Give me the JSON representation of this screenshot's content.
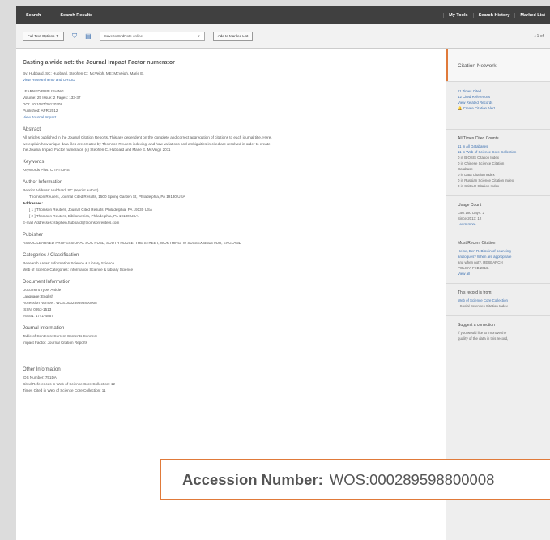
{
  "topbar": {
    "search": "Search",
    "search_results": "Search Results",
    "my_tools": "My Tools",
    "search_history": "Search History",
    "marked_list": "Marked List"
  },
  "toolbar": {
    "full_text": "Full Text Options ▼",
    "save_to": "Save to EndNote online",
    "add_marked": "Add to Marked List",
    "nav": "◂ 1 of"
  },
  "record": {
    "title": "Casting a wide net: the Journal Impact Factor numerator",
    "authors": "By: Hubbard, SC; Hubbard, Stephen C.; McVeigh, ME; McVeigh, Marie E.",
    "researcher": "View ResearcherID and ORCID",
    "publisher_short": "LEARNED PUBLISHING",
    "volume": "Volume: 25   Issue: 2   Pages: 133-37",
    "doi": "DOI: 10.1087/20120208",
    "published": "Published: APR 2012",
    "journal_impact": "View Journal Impact",
    "abstract_h": "Abstract",
    "abstract_1": "All articles published in the Journal Citation Reports. This are dependent on the complete and correct aggregation of citations to each journal title. Here,",
    "abstract_2": "we explain how unique data files are created by Thomson Reuters indexing, and how variations and ambiguities in cited are resolved in order to create",
    "abstract_3": "the Journal Impact Factor numerator. (c) Stephen C. Hubbard and Marie E. McVeigh 2011",
    "keywords_h": "Keywords",
    "keywords": "KeyWords Plus: CITATIONS",
    "author_info_h": "Author Information",
    "reprint": "Reprint Address: Hubbard, SC (reprint author)",
    "reprint_addr": "Thomson Reuters, Journal Cited Results, 1500 Spring Garden St, Philadelphia, PA 19130 USA",
    "addresses_h": "Addresses:",
    "addr1": "[ 1 ] Thomson Reuters, Journal Cited Results, Philadelphia, PA 19130 USA",
    "addr2": "[ 2 ] Thomson Reuters, Bibliometrics, Philadelphia, PA 19130 USA",
    "email": "E-mail Addresses: stephen.hubbard@thomsonreuters.com",
    "publisher_h": "Publisher",
    "publisher": "ASSOC LEARNED PROFESSIONAL SOC PUBL, SOUTH HOUSE, THE STREET, WORTHING, W SUSSEX BN14 0UU, ENGLAND",
    "categories_h": "Categories / Classification",
    "research_areas": "Research Areas: Information Science & Library Science",
    "wos_categories": "Web of Science Categories: Information Science & Library Science",
    "doc_info_h": "Document Information",
    "doc_type": "Document Type: Article",
    "language": "Language: English",
    "accession": "Accession Number: WOS:000289598800008",
    "issn": "ISSN: 0953-1513",
    "eissn": "eISSN: 1741-4857",
    "journal_info_h": "Journal Information",
    "toc": "Table of Contents: Current Contents Connect",
    "impact": "Impact Factor: Journal Citation Reports",
    "other_info_h": "Other Information",
    "ids": "IDS Number: 751DA",
    "cited_refs": "Cited References in Web of Science Core Collection: 12",
    "times_cited": "Times Cited in Web of Science Core Collection: 11"
  },
  "sidebar": {
    "header": "Citation Network",
    "times_cited": "11 Times Cited",
    "cited_refs": "12 Cited References",
    "related": "View Related Records",
    "alert": "Create Citation Alert",
    "all_times_h": "All Times Cited Counts",
    "atc1": "11 in All Databases",
    "atc2": "11 in Web of Science Core Collection",
    "atc3": "0 in BIOSIS Citation Index",
    "atc4": "0 in Chinese Science Citation",
    "atc4b": "Database",
    "atc5": "0 in Data Citation Index",
    "atc6": "0 in Russian Science Citation Index",
    "atc7": "0 in SciELO Citation Index",
    "usage_h": "Usage Count",
    "usage1": "Last 180 Days: 2",
    "usage2": "Since 2013: 12",
    "learn_more": "Learn more",
    "most_recent_h": "Most Recent Citation",
    "mr1": "Heine, Ben R. Bitcoin of bouncing",
    "mr2": "analogues? When are appropriate",
    "mr3": "and when not?. RESEARCH",
    "mr4": "POLICY, FEB 2016.",
    "view_all": "View all",
    "record_from_h": "This record is from:",
    "record_from": "Web of Science Core Collection",
    "record_from2": "- Social Sciences Citation Index",
    "suggest_h": "Suggest a correction",
    "suggest1": "If you would like to improve the",
    "suggest2": "quality of the data in this record,"
  },
  "callout": {
    "label": "Accession Number:",
    "value": "WOS:000289598800008"
  }
}
